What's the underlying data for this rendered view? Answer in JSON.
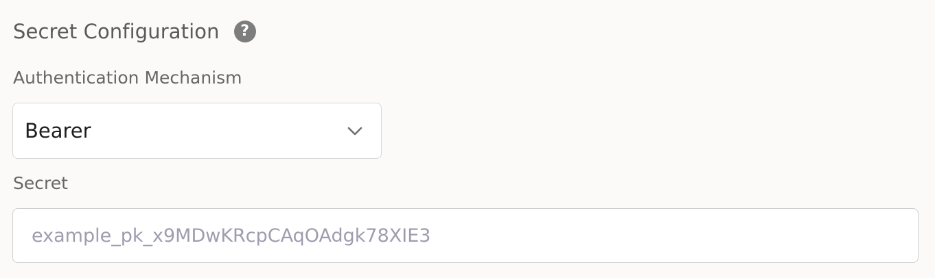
{
  "section": {
    "title": "Secret Configuration",
    "help_icon": "question-circle-icon"
  },
  "auth_mechanism": {
    "label": "Authentication Mechanism",
    "selected": "Bearer",
    "chevron_icon": "chevron-down-icon"
  },
  "secret": {
    "label": "Secret",
    "value": "",
    "placeholder": "example_pk_x9MDwKRcpCAqOAdgk78XIE3"
  }
}
